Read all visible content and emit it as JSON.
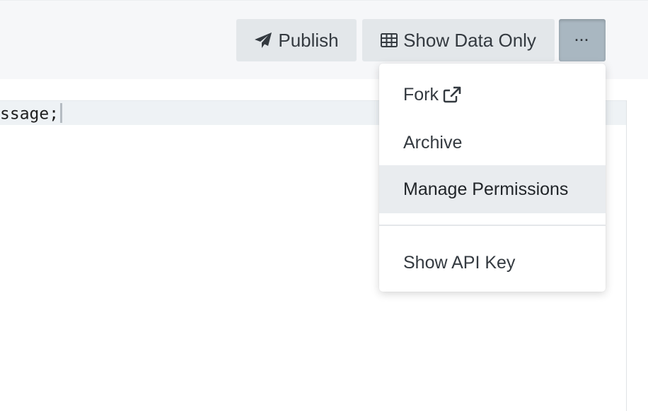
{
  "toolbar": {
    "publish_label": "Publish",
    "publish_icon": "paper-plane-icon",
    "show_data_label": "Show Data Only",
    "show_data_icon": "table-icon",
    "more_label": "···"
  },
  "editor": {
    "visible_code": "ssage;"
  },
  "dropdown": {
    "items": [
      {
        "label": "Fork",
        "icon": "external-link-icon"
      },
      {
        "label": "Archive"
      },
      {
        "label": "Manage Permissions",
        "highlighted": true
      },
      {
        "label": "Show API Key"
      }
    ]
  },
  "colors": {
    "toolbar_bg": "#f6f7f9",
    "button_bg": "#e3e7ea",
    "active_button_bg": "#a9b7c1",
    "menu_hover_bg": "#e9ecef",
    "text": "#343a40"
  }
}
